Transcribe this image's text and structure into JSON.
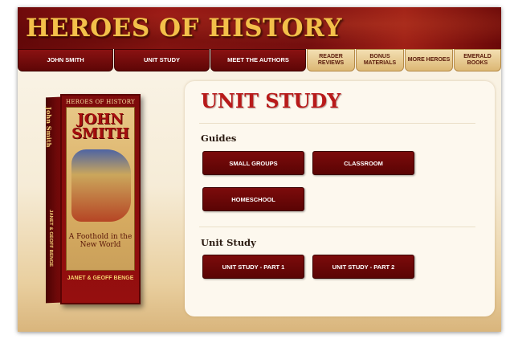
{
  "banner": {
    "title": "HEROES OF HISTORY"
  },
  "nav": {
    "john_smith": "JOHN SMITH",
    "unit_study": "UNIT STUDY",
    "meet_authors": "MEET THE AUTHORS",
    "reader_reviews": "READER REVIEWS",
    "bonus_materials": "BONUS MATERIALS",
    "more_heroes": "MORE HEROES",
    "emerald_books": "EMERALD BOOKS"
  },
  "book": {
    "series": "HEROES OF HISTORY",
    "name": "JOHN SMITH",
    "spine_title": "John Smith",
    "subtitle": "A Foothold in the New World",
    "author": "JANET & GEOFF BENGE"
  },
  "main": {
    "title": "UNIT STUDY",
    "guides_heading": "Guides",
    "guides_buttons": {
      "small_groups": "SMALL GROUPS",
      "classroom": "CLASSROOM",
      "homeschool": "HOMESCHOOL"
    },
    "unit_study_heading": "Unit Study",
    "unit_study_buttons": {
      "part1": "UNIT STUDY - PART 1",
      "part2": "UNIT STUDY - PART 2"
    }
  },
  "colors": {
    "accent_red": "#b81a1a",
    "button_dark": "#6a0707",
    "tab_light": "#dcb774",
    "title_gold": "#f3c04a"
  }
}
